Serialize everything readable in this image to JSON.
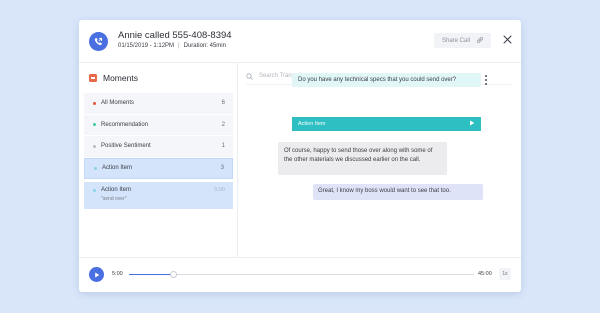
{
  "colors": {
    "accent": "#4a6fe0",
    "teal": "#2ebfc2",
    "moments_icon": "#e86a4a"
  },
  "call": {
    "title": "Annie called 555-408-8394",
    "datetime": "01/15/2019 - 1:12PM",
    "separator": "|",
    "duration": "Duration: 45min",
    "icon": "phone-icon"
  },
  "header": {
    "share_label": "Share Call",
    "share_icon": "link-icon",
    "close_icon": "close-icon"
  },
  "moments": {
    "heading": "Moments",
    "items": [
      {
        "label": "All Moments",
        "count": "6",
        "dot": "#e8553a"
      },
      {
        "label": "Recommendation",
        "count": "2",
        "dot": "#3ec9a7"
      },
      {
        "label": "Positive Sentiment",
        "count": "1",
        "dot": "#b9bec7"
      },
      {
        "label": "Action Item",
        "count": "3",
        "dot": "#8fd3e6"
      }
    ],
    "detail": {
      "label": "Action Item",
      "time": "5:00",
      "quote": "\"send over\"",
      "dot": "#8fd3e6"
    }
  },
  "transcript": {
    "search_placeholder": "Search Transcript",
    "messages": [
      {
        "text": "Do you have any technical specs that you could send over?"
      },
      {
        "text": "Of course, happy to send those over along with some of the other materials we discussed earlier on the call."
      },
      {
        "text": "Great, I know my boss would want to see that too."
      }
    ],
    "action_label": "Action Item"
  },
  "player": {
    "current": "5:00",
    "total": "45:00",
    "speed": "1x",
    "progress": 0.13
  }
}
